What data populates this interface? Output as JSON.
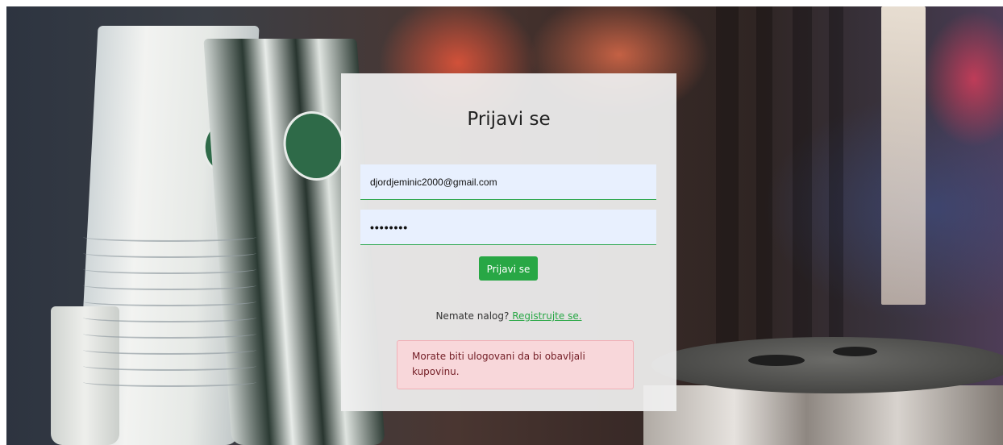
{
  "login": {
    "title": "Prijavi se",
    "email_value": "djordjeminic2000@gmail.com",
    "password_value": "••••••••",
    "submit_label": "Prijavi se",
    "register_prompt": "Nemate nalog?",
    "register_link": " Registrujte se.",
    "alert_message": "Morate biti ulogovani da bi obavljali kupovinu."
  },
  "colors": {
    "accent": "#28a745",
    "field_bg": "#e8f0fe",
    "alert_bg": "#f8d7da",
    "alert_text": "#721c24"
  }
}
